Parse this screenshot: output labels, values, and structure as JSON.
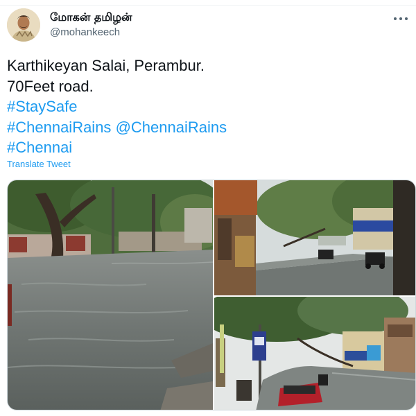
{
  "tweet": {
    "author_name": "மோகன் தமிழன்",
    "author_handle": "@mohankeech",
    "text_lines": [
      "Karthikeyan Salai, Perambur.",
      "70Feet road."
    ],
    "hashtags": {
      "stay_safe": "#StaySafe",
      "chennai_rains": "#ChennaiRains",
      "mention_chennai_rains": "@ChennaiRains",
      "chennai": "#Chennai"
    },
    "translate_label": "Translate Tweet",
    "more_menu_icon": "more-horizontal-icon",
    "photos": [
      {
        "name": "flooded-tree-lined-road-photo"
      },
      {
        "name": "flooded-street-shops-photo"
      },
      {
        "name": "flooded-road-red-car-photo"
      }
    ]
  },
  "colors": {
    "link": "#1d9bf0",
    "secondary_text": "#536471",
    "primary_text": "#0f1419",
    "border": "#cfd9de"
  }
}
